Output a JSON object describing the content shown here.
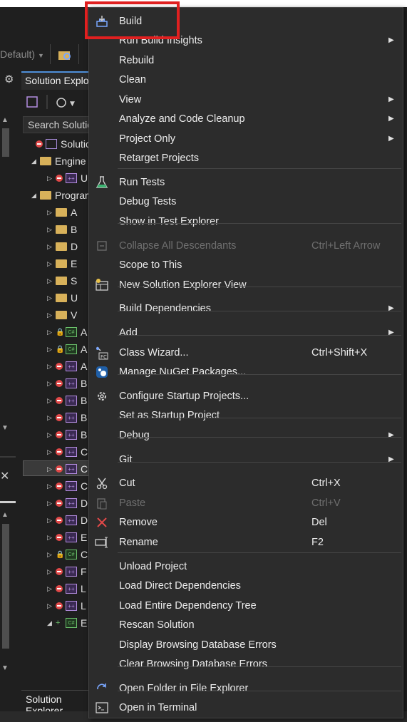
{
  "toolbar": {
    "config_value": "Default)"
  },
  "solution_explorer": {
    "tab_title": "Solution Explorer",
    "search_placeholder": "Search Solution Explorer",
    "bottom_tab": "Solution Explorer",
    "tree": [
      {
        "kind": "solution",
        "label": "Solution"
      },
      {
        "kind": "folder",
        "label": "Engine"
      },
      {
        "kind": "project",
        "label": "U"
      },
      {
        "kind": "folder",
        "label": "Programs"
      },
      {
        "kind": "folder",
        "label": "A"
      },
      {
        "kind": "folder",
        "label": "B"
      },
      {
        "kind": "folder",
        "label": "D"
      },
      {
        "kind": "folder",
        "label": "E"
      },
      {
        "kind": "folder",
        "label": "S"
      },
      {
        "kind": "folder",
        "label": "U"
      },
      {
        "kind": "folder",
        "label": "V"
      },
      {
        "kind": "cs",
        "label": "A"
      },
      {
        "kind": "cs",
        "label": "A"
      },
      {
        "kind": "project",
        "label": "A"
      },
      {
        "kind": "project",
        "label": "B"
      },
      {
        "kind": "project",
        "label": "B"
      },
      {
        "kind": "project",
        "label": "B"
      },
      {
        "kind": "project",
        "label": "B"
      },
      {
        "kind": "project",
        "label": "C"
      },
      {
        "kind": "project",
        "label": "C"
      },
      {
        "kind": "project",
        "label": "C"
      },
      {
        "kind": "project",
        "label": "D"
      },
      {
        "kind": "project",
        "label": "D"
      },
      {
        "kind": "project",
        "label": "E"
      },
      {
        "kind": "cs",
        "label": "C"
      },
      {
        "kind": "project",
        "label": "F"
      },
      {
        "kind": "project",
        "label": "L"
      },
      {
        "kind": "project",
        "label": "L"
      },
      {
        "kind": "cs",
        "label": "E"
      }
    ]
  },
  "context_menu": {
    "items": [
      {
        "label": "Build",
        "icon": "build-icon"
      },
      {
        "label": "Run Build Insights",
        "submenu": true
      },
      {
        "label": "Rebuild"
      },
      {
        "label": "Clean"
      },
      {
        "label": "View",
        "submenu": true
      },
      {
        "label": "Analyze and Code Cleanup",
        "submenu": true
      },
      {
        "label": "Project Only",
        "submenu": true
      },
      {
        "label": "Retarget Projects"
      },
      {
        "label": "Run Tests",
        "icon": "flask-icon"
      },
      {
        "label": "Debug Tests"
      },
      {
        "label": "Show in Test Explorer"
      },
      {
        "label": "Collapse All Descendants",
        "shortcut": "Ctrl+Left Arrow",
        "disabled": true,
        "icon": "collapse-icon"
      },
      {
        "label": "Scope to This"
      },
      {
        "label": "New Solution Explorer View",
        "icon": "new-view-icon"
      },
      {
        "label": "Build Dependencies",
        "submenu": true
      },
      {
        "label": "Add",
        "submenu": true
      },
      {
        "label": "Class Wizard...",
        "shortcut": "Ctrl+Shift+X",
        "icon": "class-wizard-icon"
      },
      {
        "label": "Manage NuGet Packages...",
        "icon": "nuget-icon"
      },
      {
        "label": "Configure Startup Projects...",
        "icon": "gear-icon"
      },
      {
        "label": "Set as Startup Project"
      },
      {
        "label": "Debug",
        "submenu": true
      },
      {
        "label": "Git",
        "submenu": true
      },
      {
        "label": "Cut",
        "shortcut": "Ctrl+X",
        "icon": "scissors-icon"
      },
      {
        "label": "Paste",
        "shortcut": "Ctrl+V",
        "disabled": true,
        "icon": "paste-icon"
      },
      {
        "label": "Remove",
        "shortcut": "Del",
        "icon": "remove-x-icon"
      },
      {
        "label": "Rename",
        "shortcut": "F2",
        "icon": "rename-icon"
      },
      {
        "label": "Unload Project"
      },
      {
        "label": "Load Direct Dependencies"
      },
      {
        "label": "Load Entire Dependency Tree"
      },
      {
        "label": "Rescan Solution"
      },
      {
        "label": "Display Browsing Database Errors"
      },
      {
        "label": "Clear Browsing Database Errors"
      },
      {
        "label": "Open Folder in File Explorer",
        "icon": "open-folder-icon"
      },
      {
        "label": "Open in Terminal",
        "icon": "terminal-icon"
      }
    ]
  },
  "colors": {
    "highlight_box": "#e02020",
    "menu_bg": "#2c2c2c",
    "accent": "#4f8fd9"
  }
}
